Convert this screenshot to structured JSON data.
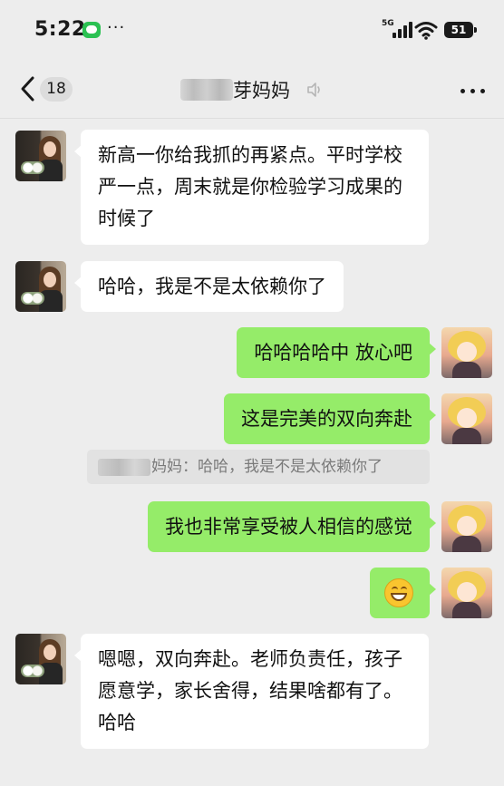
{
  "status_bar": {
    "time": "5:22",
    "more_notifications": "···",
    "network_type": "5G",
    "battery_level": "51",
    "icons": [
      "wechat-notification-icon",
      "signal-icon",
      "wifi-icon",
      "battery-icon"
    ]
  },
  "nav": {
    "unread_count": "18",
    "title_visible": "芽妈妈",
    "title_redacted": true,
    "icons": [
      "back-icon",
      "mute-icon",
      "more-icon"
    ]
  },
  "colors": {
    "background": "#ededed",
    "incoming_bubble": "#ffffff",
    "outgoing_bubble": "#95ec69",
    "quote_background": "#e2e2e2",
    "quote_text": "#7a7a7a"
  },
  "messages": [
    {
      "sender": "other",
      "text": "新高一你给我抓的再紧点。平时学校严一点，周末就是你检验学习成果的时候了"
    },
    {
      "sender": "other",
      "text": "哈哈，我是不是太依赖你了"
    },
    {
      "sender": "me",
      "text": "哈哈哈哈中 放心吧"
    },
    {
      "sender": "me",
      "text": "这是完美的双向奔赴"
    },
    {
      "sender": "me",
      "text": "我也非常享受被人相信的感觉"
    },
    {
      "sender": "me",
      "emoji": "grinning-face-emoji"
    },
    {
      "sender": "other",
      "text": "嗯嗯，双向奔赴。老师负责任，孩子愿意学，家长舍得，结果啥都有了。哈哈"
    }
  ],
  "quote": {
    "sender_redacted": true,
    "text": "妈妈：哈哈，我是不是太依赖你了"
  }
}
